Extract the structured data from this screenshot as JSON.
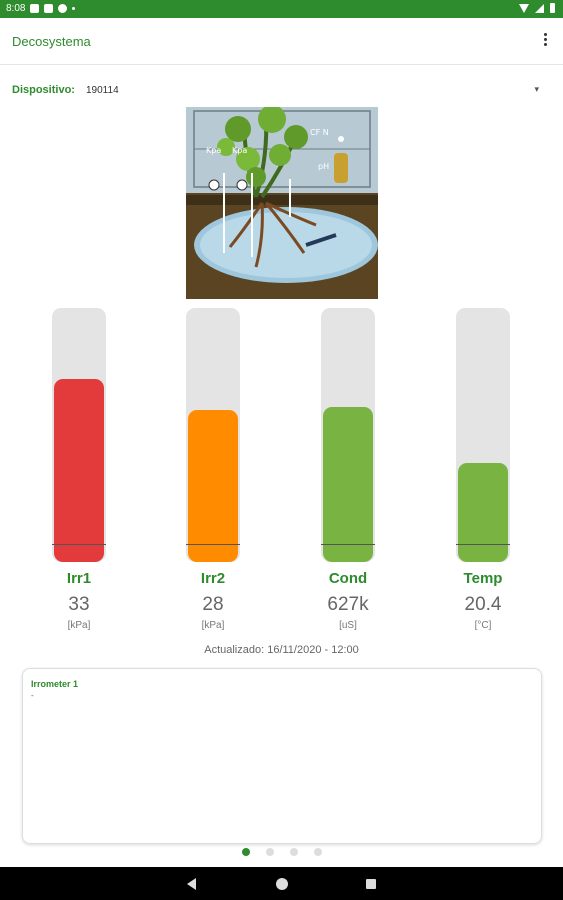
{
  "status_bar": {
    "time": "8:08"
  },
  "app": {
    "title": "Decosystema"
  },
  "device": {
    "label": "Dispositivo:",
    "value": "190114"
  },
  "gauges": [
    {
      "label": "Irr1",
      "value": "33",
      "unit": "[kPa]",
      "color": "#e33b3b",
      "fill_fraction": 0.72
    },
    {
      "label": "Irr2",
      "value": "28",
      "unit": "[kPa]",
      "color": "#ff8c00",
      "fill_fraction": 0.6
    },
    {
      "label": "Cond",
      "value": "627k",
      "unit": "[uS]",
      "color": "#79b443",
      "fill_fraction": 0.61
    },
    {
      "label": "Temp",
      "value": "20.4",
      "unit": "[°C]",
      "color": "#79b443",
      "fill_fraction": 0.39
    }
  ],
  "updated": "Actualizado: 16/11/2020 - 12:00",
  "card": {
    "title": "Irrometer 1",
    "value": "-"
  },
  "pager": {
    "pages": 4,
    "active": 0
  },
  "illustration": {
    "labels": {
      "cf": "CF N",
      "kpa1": "Kpa",
      "kpa2": "Kpa",
      "ph": "pH"
    }
  }
}
